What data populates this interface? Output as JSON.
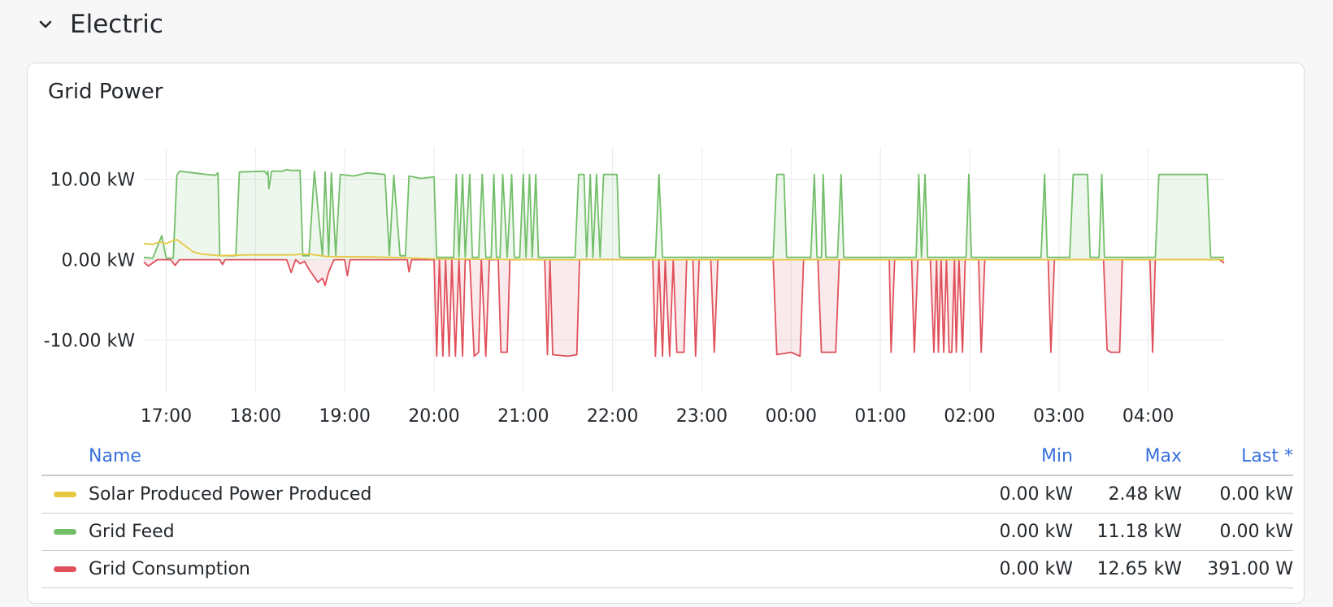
{
  "row": {
    "title": "Electric"
  },
  "panel": {
    "title": "Grid Power"
  },
  "colors": {
    "solar": "#e6c842",
    "feed": "#73bf69",
    "consumption": "#e0515c"
  },
  "legend": {
    "headers": {
      "name": "Name",
      "min": "Min",
      "max": "Max",
      "last": "Last *"
    },
    "rows": [
      {
        "name": "Solar Produced Power Produced",
        "min": "0.00 kW",
        "max": "2.48 kW",
        "last": "0.00 kW",
        "color": "#e6c842"
      },
      {
        "name": "Grid Feed",
        "min": "0.00 kW",
        "max": "11.18 kW",
        "last": "0.00 kW",
        "color": "#73bf69"
      },
      {
        "name": "Grid Consumption",
        "min": "0.00 kW",
        "max": "12.65 kW",
        "last": "391.00 W",
        "color": "#e0515c"
      }
    ]
  },
  "chart_data": {
    "type": "area",
    "title": "Grid Power",
    "x_unit": "hours",
    "xlim": [
      16.75,
      28.85
    ],
    "ylim": [
      -16.5,
      14
    ],
    "grid": true,
    "yticks": [
      {
        "value": 10,
        "label": "10.00 kW"
      },
      {
        "value": 0,
        "label": "0.00 kW"
      },
      {
        "value": -10,
        "label": "-10.00 kW"
      }
    ],
    "xticks": [
      {
        "value": 17,
        "label": "17:00"
      },
      {
        "value": 18,
        "label": "18:00"
      },
      {
        "value": 19,
        "label": "19:00"
      },
      {
        "value": 20,
        "label": "20:00"
      },
      {
        "value": 21,
        "label": "21:00"
      },
      {
        "value": 22,
        "label": "22:00"
      },
      {
        "value": 23,
        "label": "23:00"
      },
      {
        "value": 24,
        "label": "00:00"
      },
      {
        "value": 25,
        "label": "01:00"
      },
      {
        "value": 26,
        "label": "02:00"
      },
      {
        "value": 27,
        "label": "03:00"
      },
      {
        "value": 28,
        "label": "04:00"
      }
    ],
    "series": [
      {
        "name": "Solar Produced Power Produced",
        "key": "solar",
        "fill": false,
        "points": [
          [
            16.75,
            2.0
          ],
          [
            16.85,
            1.9
          ],
          [
            16.92,
            2.2
          ],
          [
            17.0,
            2.0
          ],
          [
            17.08,
            2.4
          ],
          [
            17.12,
            2.5
          ],
          [
            17.18,
            2.0
          ],
          [
            17.3,
            1.0
          ],
          [
            17.4,
            0.7
          ],
          [
            17.6,
            0.5
          ],
          [
            17.9,
            0.6
          ],
          [
            18.4,
            0.6
          ],
          [
            18.6,
            0.7
          ],
          [
            18.8,
            0.4
          ],
          [
            19.3,
            0.35
          ],
          [
            19.8,
            0.2
          ],
          [
            20.0,
            0.1
          ],
          [
            20.6,
            0.05
          ],
          [
            21.0,
            0.0
          ],
          [
            28.85,
            0.0
          ]
        ]
      },
      {
        "name": "Grid Feed",
        "key": "feed",
        "fill": true,
        "points": [
          [
            16.75,
            0.3
          ],
          [
            16.85,
            0.2
          ],
          [
            16.95,
            3.0
          ],
          [
            17.0,
            0.2
          ],
          [
            17.08,
            0.2
          ],
          [
            17.12,
            10.5
          ],
          [
            17.15,
            11.0
          ],
          [
            17.3,
            10.8
          ],
          [
            17.45,
            10.6
          ],
          [
            17.55,
            10.5
          ],
          [
            17.58,
            10.8
          ],
          [
            17.6,
            0.5
          ],
          [
            17.78,
            0.5
          ],
          [
            17.82,
            10.9
          ],
          [
            18.1,
            11.0
          ],
          [
            18.13,
            10.6
          ],
          [
            18.14,
            11.0
          ],
          [
            18.15,
            8.8
          ],
          [
            18.18,
            11.0
          ],
          [
            18.3,
            11.0
          ],
          [
            18.35,
            11.2
          ],
          [
            18.4,
            11.1
          ],
          [
            18.5,
            11.1
          ],
          [
            18.53,
            0.5
          ],
          [
            18.6,
            0.5
          ],
          [
            18.66,
            11.0
          ],
          [
            18.75,
            0.5
          ],
          [
            18.78,
            10.9
          ],
          [
            18.82,
            0.5
          ],
          [
            18.85,
            10.8
          ],
          [
            18.9,
            0.5
          ],
          [
            18.95,
            10.6
          ],
          [
            19.1,
            10.4
          ],
          [
            19.25,
            10.8
          ],
          [
            19.45,
            10.6
          ],
          [
            19.5,
            0.5
          ],
          [
            19.55,
            10.5
          ],
          [
            19.62,
            0.5
          ],
          [
            19.68,
            0.5
          ],
          [
            19.72,
            10.4
          ],
          [
            19.85,
            10.1
          ],
          [
            20.0,
            10.3
          ],
          [
            20.03,
            0.3
          ],
          [
            20.22,
            0.3
          ],
          [
            20.25,
            10.6
          ],
          [
            20.28,
            0.3
          ],
          [
            20.32,
            10.6
          ],
          [
            20.35,
            0.3
          ],
          [
            20.4,
            10.6
          ],
          [
            20.43,
            0.3
          ],
          [
            20.5,
            0.3
          ],
          [
            20.54,
            10.6
          ],
          [
            20.58,
            0.3
          ],
          [
            20.64,
            0.3
          ],
          [
            20.67,
            10.6
          ],
          [
            20.7,
            0.3
          ],
          [
            20.74,
            0.3
          ],
          [
            20.77,
            10.6
          ],
          [
            20.82,
            0.3
          ],
          [
            20.87,
            10.6
          ],
          [
            20.9,
            0.3
          ],
          [
            20.96,
            0.3
          ],
          [
            21.0,
            10.6
          ],
          [
            21.03,
            0.3
          ],
          [
            21.07,
            10.6
          ],
          [
            21.1,
            0.3
          ],
          [
            21.14,
            10.6
          ],
          [
            21.17,
            0.3
          ],
          [
            21.58,
            0.3
          ],
          [
            21.62,
            10.6
          ],
          [
            21.68,
            10.6
          ],
          [
            21.71,
            0.3
          ],
          [
            21.75,
            10.6
          ],
          [
            21.78,
            0.3
          ],
          [
            21.82,
            10.6
          ],
          [
            21.86,
            0.3
          ],
          [
            21.9,
            10.6
          ],
          [
            22.05,
            10.6
          ],
          [
            22.08,
            0.3
          ],
          [
            22.48,
            0.3
          ],
          [
            22.52,
            10.6
          ],
          [
            22.56,
            0.3
          ],
          [
            23.8,
            0.3
          ],
          [
            23.84,
            10.6
          ],
          [
            23.92,
            10.6
          ],
          [
            23.95,
            0.3
          ],
          [
            24.22,
            0.3
          ],
          [
            24.26,
            10.6
          ],
          [
            24.29,
            0.3
          ],
          [
            24.34,
            0.3
          ],
          [
            24.36,
            10.6
          ],
          [
            24.39,
            0.3
          ],
          [
            24.52,
            0.3
          ],
          [
            24.56,
            10.6
          ],
          [
            24.59,
            0.3
          ],
          [
            25.4,
            0.3
          ],
          [
            25.43,
            10.6
          ],
          [
            25.46,
            0.3
          ],
          [
            25.5,
            10.6
          ],
          [
            25.53,
            0.3
          ],
          [
            25.96,
            0.3
          ],
          [
            25.99,
            10.6
          ],
          [
            26.02,
            0.3
          ],
          [
            26.8,
            0.3
          ],
          [
            26.84,
            10.6
          ],
          [
            26.87,
            0.3
          ],
          [
            27.12,
            0.3
          ],
          [
            27.16,
            10.6
          ],
          [
            27.32,
            10.6
          ],
          [
            27.35,
            0.3
          ],
          [
            27.45,
            0.3
          ],
          [
            27.48,
            10.6
          ],
          [
            27.51,
            0.3
          ],
          [
            28.08,
            0.3
          ],
          [
            28.12,
            10.6
          ],
          [
            28.66,
            10.6
          ],
          [
            28.7,
            0.3
          ],
          [
            28.85,
            0.3
          ]
        ]
      },
      {
        "name": "Grid Consumption",
        "key": "consumption",
        "fill": true,
        "points": [
          [
            16.75,
            -0.3
          ],
          [
            16.8,
            -0.8
          ],
          [
            16.9,
            0.0
          ],
          [
            17.05,
            0.0
          ],
          [
            17.1,
            -0.7
          ],
          [
            17.15,
            0.0
          ],
          [
            17.6,
            0.0
          ],
          [
            17.63,
            -0.6
          ],
          [
            17.66,
            0.0
          ],
          [
            18.35,
            0.0
          ],
          [
            18.4,
            -1.6
          ],
          [
            18.45,
            0.0
          ],
          [
            18.5,
            -0.5
          ],
          [
            18.55,
            -0.2
          ],
          [
            18.6,
            -1.2
          ],
          [
            18.65,
            -2.0
          ],
          [
            18.7,
            -2.8
          ],
          [
            18.75,
            -2.3
          ],
          [
            18.78,
            -3.2
          ],
          [
            18.82,
            -1.5
          ],
          [
            18.88,
            0.0
          ],
          [
            19.0,
            0.0
          ],
          [
            19.03,
            -2.0
          ],
          [
            19.06,
            0.0
          ],
          [
            19.7,
            0.0
          ],
          [
            19.72,
            -1.5
          ],
          [
            19.75,
            0.0
          ],
          [
            20.0,
            0.0
          ],
          [
            20.03,
            -12.0
          ],
          [
            20.06,
            0.0
          ],
          [
            20.1,
            -12.0
          ],
          [
            20.13,
            0.0
          ],
          [
            20.17,
            -12.0
          ],
          [
            20.2,
            0.0
          ],
          [
            20.24,
            -12.0
          ],
          [
            20.28,
            0.0
          ],
          [
            20.32,
            -12.0
          ],
          [
            20.35,
            0.0
          ],
          [
            20.4,
            0.0
          ],
          [
            20.45,
            -12.0
          ],
          [
            20.5,
            -11.5
          ],
          [
            20.53,
            0.0
          ],
          [
            20.58,
            -12.0
          ],
          [
            20.62,
            0.0
          ],
          [
            20.72,
            0.0
          ],
          [
            20.75,
            -11.5
          ],
          [
            20.82,
            -11.5
          ],
          [
            20.85,
            0.0
          ],
          [
            21.24,
            0.0
          ],
          [
            21.27,
            -11.8
          ],
          [
            21.3,
            0.0
          ],
          [
            21.33,
            -11.8
          ],
          [
            21.5,
            -12.0
          ],
          [
            21.6,
            -11.8
          ],
          [
            21.63,
            0.0
          ],
          [
            22.45,
            0.0
          ],
          [
            22.48,
            -12.0
          ],
          [
            22.52,
            0.0
          ],
          [
            22.56,
            -12.0
          ],
          [
            22.59,
            0.0
          ],
          [
            22.64,
            -12.0
          ],
          [
            22.68,
            0.0
          ],
          [
            22.72,
            -11.5
          ],
          [
            22.8,
            -11.5
          ],
          [
            22.83,
            0.0
          ],
          [
            22.9,
            0.0
          ],
          [
            22.93,
            -12.0
          ],
          [
            22.97,
            0.0
          ],
          [
            23.1,
            0.0
          ],
          [
            23.14,
            -11.5
          ],
          [
            23.18,
            0.0
          ],
          [
            23.8,
            0.0
          ],
          [
            23.84,
            -11.8
          ],
          [
            24.0,
            -11.5
          ],
          [
            24.1,
            -12.0
          ],
          [
            24.14,
            0.0
          ],
          [
            24.3,
            0.0
          ],
          [
            24.34,
            -11.5
          ],
          [
            24.5,
            -11.5
          ],
          [
            24.54,
            0.0
          ],
          [
            25.1,
            0.0
          ],
          [
            25.12,
            -11.5
          ],
          [
            25.16,
            0.0
          ],
          [
            25.35,
            0.0
          ],
          [
            25.38,
            -11.5
          ],
          [
            25.42,
            0.0
          ],
          [
            25.56,
            0.0
          ],
          [
            25.6,
            -11.5
          ],
          [
            25.63,
            0.0
          ],
          [
            25.65,
            -11.5
          ],
          [
            25.68,
            0.0
          ],
          [
            25.71,
            -11.5
          ],
          [
            25.74,
            0.0
          ],
          [
            25.77,
            -11.5
          ],
          [
            25.8,
            -11.5
          ],
          [
            25.83,
            0.0
          ],
          [
            25.85,
            -11.5
          ],
          [
            25.88,
            0.0
          ],
          [
            25.92,
            -11.5
          ],
          [
            25.95,
            0.0
          ],
          [
            26.1,
            0.0
          ],
          [
            26.13,
            -11.5
          ],
          [
            26.17,
            0.0
          ],
          [
            26.88,
            0.0
          ],
          [
            26.91,
            -11.5
          ],
          [
            26.95,
            0.0
          ],
          [
            27.5,
            0.0
          ],
          [
            27.54,
            -11.2
          ],
          [
            27.58,
            -11.5
          ],
          [
            27.68,
            -11.5
          ],
          [
            27.71,
            0.0
          ],
          [
            28.02,
            0.0
          ],
          [
            28.05,
            -11.5
          ],
          [
            28.08,
            0.0
          ],
          [
            28.8,
            0.0
          ],
          [
            28.85,
            -0.4
          ]
        ]
      }
    ]
  }
}
